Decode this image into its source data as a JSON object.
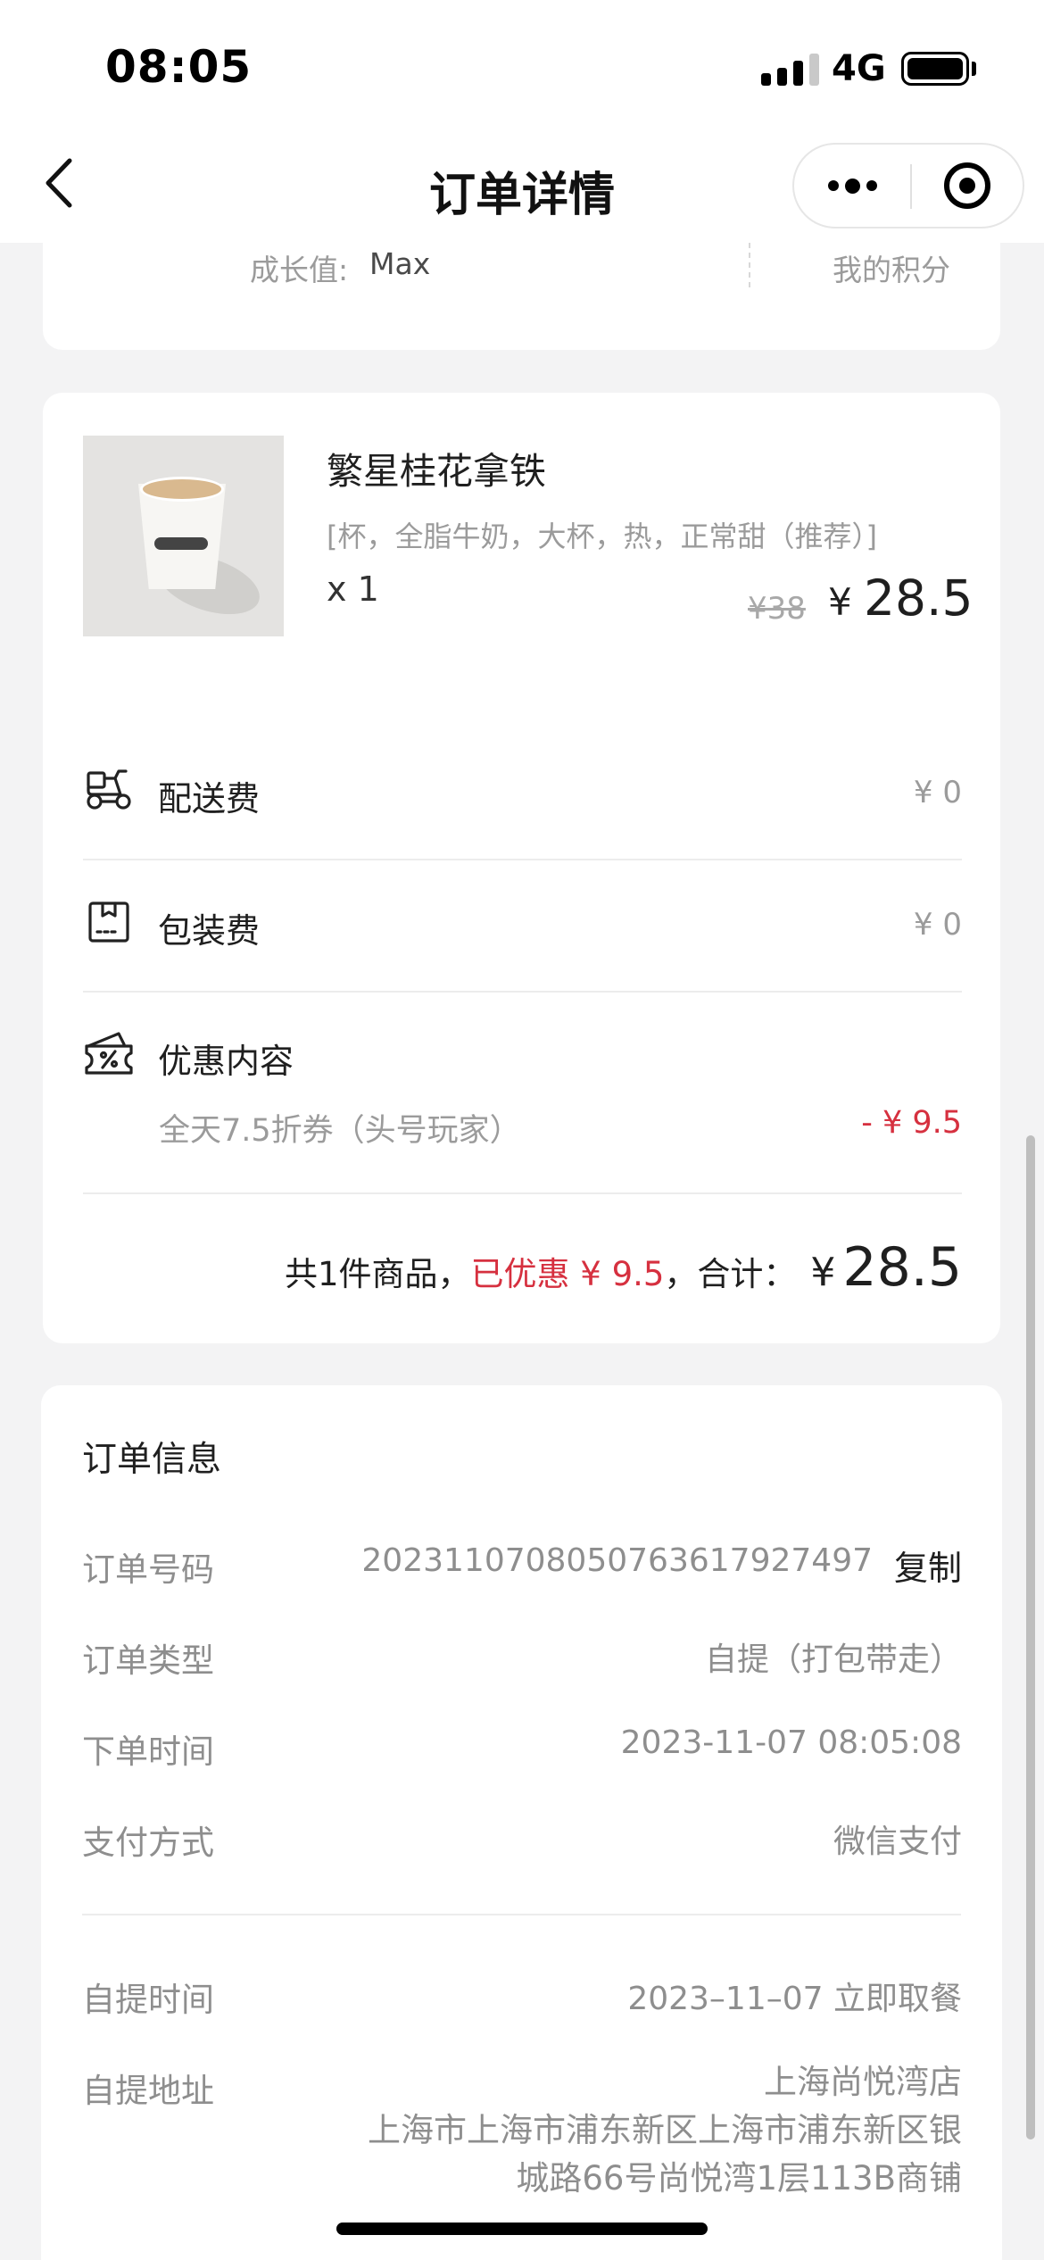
{
  "status_bar": {
    "time": "08:05",
    "network": "4G"
  },
  "header": {
    "title": "订单详情"
  },
  "member": {
    "growth_label": "成长值:",
    "growth_value": "Max",
    "points_label": "我的积分"
  },
  "product": {
    "name": "繁星桂花拿铁",
    "spec": "[杯，全脂牛奶，大杯，热，正常甜（推荐）]",
    "quantity": "x 1",
    "original_price": "¥38",
    "currency": "¥",
    "price": "28.5"
  },
  "fees": [
    {
      "label": "配送费",
      "value": "¥ 0",
      "icon": "scooter-icon"
    },
    {
      "label": "包装费",
      "value": "¥ 0",
      "icon": "package-icon"
    }
  ],
  "discount": {
    "label": "优惠内容",
    "icon": "coupon-icon",
    "description": "全天7.5折券（头号玩家）",
    "value": "- ¥ 9.5"
  },
  "summary": {
    "count_text": "共1件商品，",
    "saved_text": "已优惠 ¥ 9.5",
    "total_label": "，合计：",
    "currency": "¥",
    "total": "28.5"
  },
  "order_info": {
    "title": "订单信息",
    "order_number_label": "订单号码",
    "order_number": "2023110708050763617927497",
    "copy_label": "复制",
    "order_type_label": "订单类型",
    "order_type": "自提（打包带走）",
    "order_time_label": "下单时间",
    "order_time": "2023-11-07 08:05:08",
    "payment_label": "支付方式",
    "payment": "微信支付",
    "pickup_time_label": "自提时间",
    "pickup_time": "2023–11–07 立即取餐",
    "pickup_address_label": "自提地址",
    "store_name": "上海尚悦湾店",
    "address_line1": "上海市上海市浦东新区上海市浦东新区银",
    "address_line2": "城路66号尚悦湾1层113B商铺"
  },
  "colors": {
    "accent_red": "#d6303f",
    "background": "#f3f3f4",
    "muted": "#9b9b9b"
  }
}
